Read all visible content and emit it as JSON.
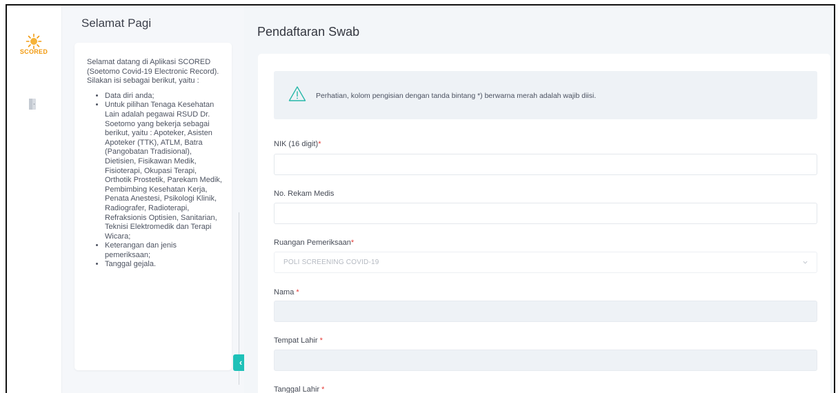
{
  "app": {
    "logo_text": "SCORED"
  },
  "sidebar": {
    "greeting": "Selamat Pagi",
    "intro": "Selamat datang di Aplikasi SCORED (Soetomo Covid-19 Electronic Record). Silakan isi sebagai berikut, yaitu :",
    "items": [
      "Data diri anda;",
      "Untuk pilihan Tenaga Kesehatan Lain adalah pegawai RSUD Dr. Soetomo yang bekerja sebagai berikut, yaitu : Apoteker, Asisten Apoteker (TTK), ATLM, Batra (Pangobatan Tradisional), Dietisien, Fisikawan Medik, Fisioterapi, Okupasi Terapi, Orthotik Prostetik, Parekam Medik, Pembimbing Kesehatan Kerja, Penata Anestesi, Psikologi Klinik, Radiografer, Radioterapi, Refraksionis Optisien, Sanitarian, Teknisi Elektromedik dan Terapi Wicara;",
      "Keterangan dan jenis pemeriksaan;",
      "Tanggal gejala."
    ],
    "collapse_glyph": "‹"
  },
  "main": {
    "title": "Pendaftaran Swab",
    "alert": "Perhatian, kolom pengisian dengan tanda bintang *) berwarna merah adalah wajib diisi.",
    "required_mark": "*",
    "fields": {
      "nik": {
        "label": "NIK (16 digit)",
        "value": "",
        "placeholder": ""
      },
      "rekam_medis": {
        "label": "No. Rekam Medis",
        "value": "",
        "placeholder": ""
      },
      "ruangan": {
        "label": "Ruangan Pemeriksaan",
        "value": "POLI SCREENING COVID-19"
      },
      "nama": {
        "label": "Nama ",
        "value": ""
      },
      "tempat_lahir": {
        "label": "Tempat Lahir ",
        "value": ""
      },
      "tanggal_lahir": {
        "label": "Tanggal Lahir "
      }
    }
  },
  "colors": {
    "accent": "#1ec1b8",
    "logo": "#f29a0f",
    "required": "#e53935"
  },
  "icons": [
    "sun-logo-icon",
    "door-exit-icon",
    "warning-triangle-icon",
    "chevron-left-icon",
    "chevron-down-icon"
  ]
}
